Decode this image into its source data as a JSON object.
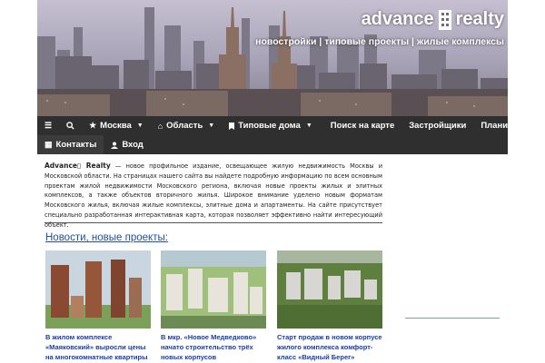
{
  "header": {
    "logo_left": "advance",
    "logo_right": "realty",
    "tagline": "новостройки | типовые проекты | жилые комплексы"
  },
  "nav": {
    "menu_icon": "menu-icon",
    "search_icon": "search-icon",
    "items": [
      {
        "label": "Москва",
        "icon": "star-icon",
        "dropdown": true
      },
      {
        "label": "Область",
        "icon": "home-icon",
        "dropdown": true
      },
      {
        "label": "Типовые дома",
        "icon": "bookmark-icon",
        "dropdown": true
      },
      {
        "label": "Поиск на карте"
      },
      {
        "label": "Застройщики"
      },
      {
        "label": "Планировки"
      }
    ],
    "row2": [
      {
        "label": "Контакты",
        "icon": "contacts-icon"
      },
      {
        "label": "Вход",
        "icon": "user-icon"
      }
    ]
  },
  "intro": {
    "brand": "Advance▯ Realty",
    "text": " — новое профильное издание, освещающее жилую недвижимость Москвы и Московской области. На страницах нашего сайта вы найдете подробную информацию по всем основным проектам жилой недвижимости Московского региона, включая новые проекты жилых и элитных комплексов, а также объектов вторичного жилья. Широкое внимание уделено новым форматам Московского жилья, включая жилые комплексы, элитные дома и апартаменты. На сайте присутствует специально разработанная интерактивная карта, которая позволяет эффективно найти интересующий объект."
  },
  "news": {
    "title": "Новости, новые проекты:",
    "cards": [
      {
        "caption": "В жилом комплексе «Маяковский» выросли цены на многокомнатные квартиры"
      },
      {
        "caption": "В мкр. «Новое Медведково» начато строительство трёх новых корпусов"
      },
      {
        "caption": "Старт продаж в новом корпусе жилого комплекса комфорт-класс «Видный Берег»"
      }
    ]
  },
  "colors": {
    "nav_bg": "#2f2f2f",
    "link": "#1a3e9e"
  }
}
